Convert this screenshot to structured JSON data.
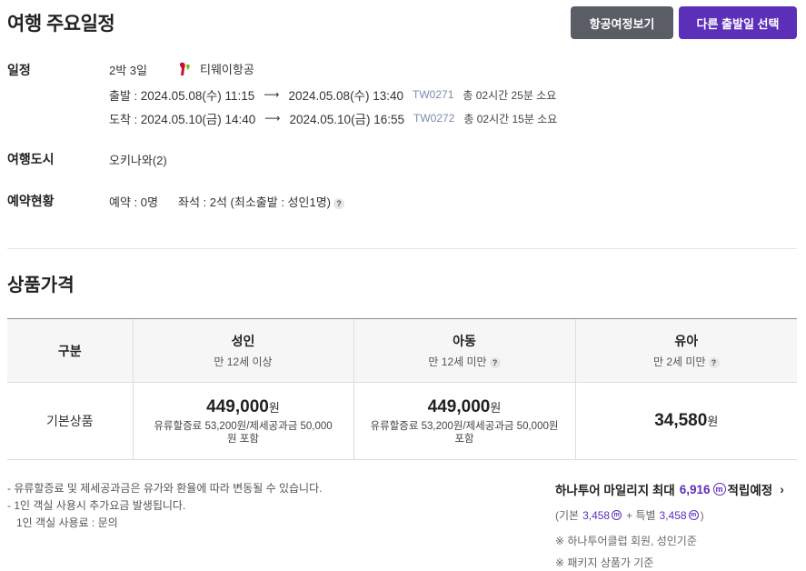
{
  "header": {
    "title": "여행 주요일정",
    "flight_button": "항공여정보기",
    "other_date_button": "다른 출발일 선택"
  },
  "schedule": {
    "label": "일정",
    "duration": "2박 3일",
    "airline": "티웨이항공",
    "departure": {
      "prefix": "출발 :",
      "from": "2024.05.08(수) 11:15",
      "to": "2024.05.08(수) 13:40",
      "code": "TW0271",
      "duration": "총 02시간 25분 소요"
    },
    "arrival": {
      "prefix": "도착 :",
      "from": "2024.05.10(금) 14:40",
      "to": "2024.05.10(금) 16:55",
      "code": "TW0272",
      "duration": "총 02시간 15분 소요"
    }
  },
  "city": {
    "label": "여행도시",
    "value": "오키나와(2)"
  },
  "booking": {
    "label": "예약현황",
    "reserved": "예약 : 0명",
    "seats": "좌석 : 2석 (최소출발 : 성인1명)"
  },
  "price_section": {
    "title": "상품가격",
    "columns": [
      {
        "main": "구분",
        "sub": ""
      },
      {
        "main": "성인",
        "sub": "만 12세 이상"
      },
      {
        "main": "아동",
        "sub": "만 12세 미만"
      },
      {
        "main": "유아",
        "sub": "만 2세 미만"
      }
    ],
    "row": {
      "name": "기본상품",
      "adult": {
        "price": "449,000",
        "unit": "원",
        "note": "유류할증료 53,200원/제세공과금 50,000원 포함"
      },
      "child": {
        "price": "449,000",
        "unit": "원",
        "note": "유류할증료 53,200원/제세공과금 50,000원 포함"
      },
      "infant": {
        "price": "34,580",
        "unit": "원"
      }
    }
  },
  "notes": {
    "line1": "- 유류할증료 및 제세공과금은 유가와 환율에 따라 변동될 수 있습니다.",
    "line2": "- 1인 객실 사용시 추가요금 발생됩니다.",
    "line3": "1인 객실 사용료 : 문의"
  },
  "mileage": {
    "title_prefix": "하나투어 마일리지 최대",
    "amount": "6,916",
    "icon_letter": "m",
    "title_suffix": "적립예정",
    "base_prefix": "(기본",
    "base_value": "3,458",
    "plus_special": "+ 특별",
    "special_value": "3,458",
    "close_paren": ")",
    "note1": "※ 하나투어클럽 회원, 성인기준",
    "note2": "※ 패키지 상품가 기준"
  },
  "colors": {
    "accent": "#5b2fb8",
    "secondary_button": "#5a5d66",
    "flight_code": "#7a8bb0"
  }
}
